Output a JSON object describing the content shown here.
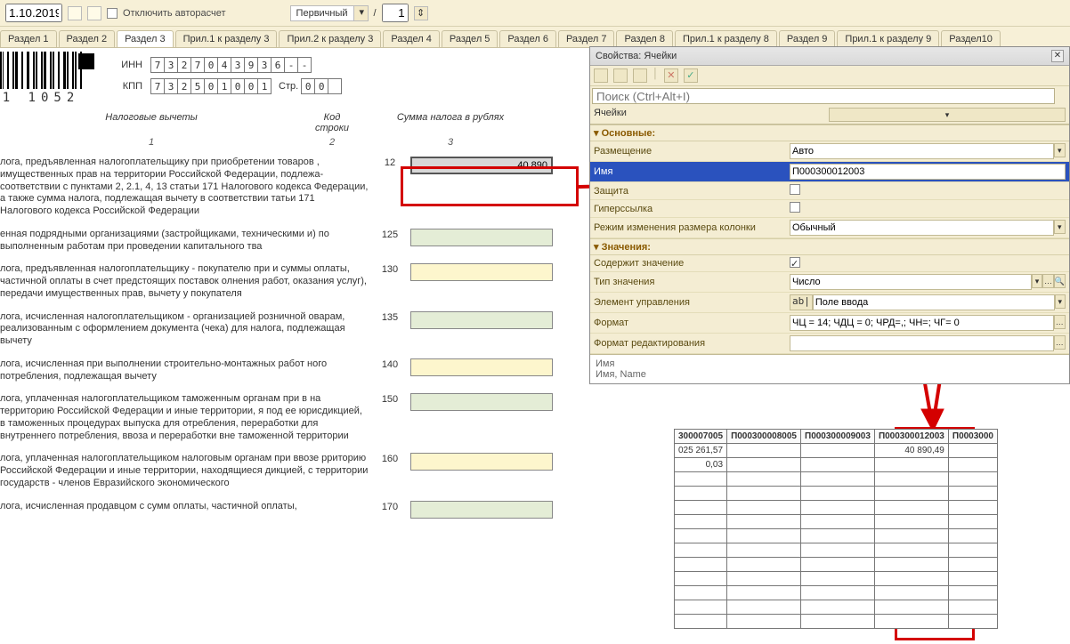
{
  "topbar": {
    "date": "1.10.2019",
    "disable_autocalc": "Отключить авторасчет",
    "doctype": "Первичный",
    "slash": "/",
    "num": "1",
    "dd": "▾"
  },
  "tabs": [
    "Раздел 1",
    "Раздел 2",
    "Раздел 3",
    "Прил.1 к разделу 3",
    "Прил.2 к разделу 3",
    "Раздел 4",
    "Раздел 5",
    "Раздел 6",
    "Раздел 7",
    "Раздел 8",
    "Прил.1 к разделу 8",
    "Раздел 9",
    "Прил.1 к разделу 9",
    "Раздел10"
  ],
  "active_tab": 2,
  "header": {
    "inn_label": "ИНН",
    "inn": [
      "7",
      "3",
      "2",
      "7",
      "0",
      "4",
      "3",
      "9",
      "3",
      "6",
      "-",
      "-"
    ],
    "kpp_label": "КПП",
    "kpp": [
      "7",
      "3",
      "2",
      "5",
      "0",
      "1",
      "0",
      "0",
      "1"
    ],
    "str_label": "Стр.",
    "str": [
      "0",
      "0",
      ""
    ],
    "barcode_text": "1 1052"
  },
  "cols": {
    "tax": "Налоговые вычеты",
    "code": "Код\nстроки",
    "sum": "Сумма налога в рублях",
    "n1": "1",
    "n2": "2",
    "n3": "3"
  },
  "rows": [
    {
      "txt": "лога, предъявленная налогоплательщику при приобретении товаров , имущественных прав на территории Российской Федерации, подлежа- соответствии с пунктами 2, 2.1, 4, 13 статьи 171 Налогового кодекса Федерации, а также сумма налога, подлежащая вычету в соответствии татьи 171 Налогового кодекса Российской Федерации",
      "code": "12",
      "val": "40 890",
      "hl": true
    },
    {
      "txt": "енная подрядными организациями (застройщиками, техническими и) по выполненным работам при проведении капитального тва",
      "code": "125",
      "val": ""
    },
    {
      "txt": "лога, предъявленная налогоплательщику - покупателю при и суммы оплаты, частичной оплаты в счет предстоящих поставок олнения работ, оказания услуг), передачи имущественных прав, вычету у покупателя",
      "code": "130",
      "val": ""
    },
    {
      "txt": "лога, исчисленная налогоплательщиком - организацией розничной оварам, реализованным с оформлением документа (чека) для  налога, подлежащая вычету",
      "code": "135",
      "val": ""
    },
    {
      "txt": "лога, исчисленная при выполнении строительно-монтажных работ ного потребления, подлежащая вычету",
      "code": "140",
      "val": ""
    },
    {
      "txt": "лога, уплаченная налогоплательщиком таможенным органам при в на территорию Российской Федерации и иные территории, я под ее юрисдикцией, в таможенных процедурах выпуска для отребления, переработки для внутреннего потребления, ввоза и переработки вне таможенной территории",
      "code": "150",
      "val": ""
    },
    {
      "txt": "лога, уплаченная налогоплательщиком налоговым органам при ввозе рриторию Российской Федерации и иные территории, находящиеся дикцией, с территории государств - членов Евразийского экономического",
      "code": "160",
      "val": ""
    },
    {
      "txt": "лога, исчисленная продавцом с сумм оплаты, частичной оплаты,",
      "code": "170",
      "val": ""
    }
  ],
  "props": {
    "title": "Свойства: Ячейки",
    "search_ph": "Поиск (Ctrl+Alt+I)",
    "category": "Ячейки",
    "sec_main": "Основные:",
    "sec_vals": "Значения:",
    "rows_main": [
      {
        "k": "Размещение",
        "v": "Авто",
        "dd": true
      },
      {
        "k": "Имя",
        "v": "П000300012003",
        "hl": true
      },
      {
        "k": "Защита",
        "v": "",
        "check": true
      },
      {
        "k": "Гиперссылка",
        "v": "",
        "check": true
      },
      {
        "k": "Режим изменения размера колонки",
        "v": "Обычный",
        "dd": true
      }
    ],
    "rows_vals": [
      {
        "k": "Содержит значение",
        "v": "",
        "check": true,
        "checked": true
      },
      {
        "k": "Тип значения",
        "v": "Число",
        "dd": true,
        "extra": true
      },
      {
        "k": "Элемент управления",
        "v": "Поле ввода",
        "dd": true,
        "prefix": "ab|"
      },
      {
        "k": "Формат",
        "v": "ЧЦ = 14; ЧДЦ = 0; ЧРД=,; ЧН=; ЧГ= 0",
        "btn": true
      },
      {
        "k": "Формат редактирования",
        "v": "",
        "btn": true
      }
    ],
    "foot1": "Имя",
    "foot2": "Имя, Name"
  },
  "table": {
    "headers": [
      "300007005",
      "П000300008005",
      "П000300009003",
      "П000300012003",
      "П0003000"
    ],
    "row1": [
      "025 261,57",
      "",
      "",
      "40 890,49",
      ""
    ],
    "row2": [
      "0,03",
      "",
      "",
      "",
      ""
    ]
  },
  "icons": {
    "close": "✕",
    "check": "✓",
    "dd": "▾",
    "dots": "…",
    "x": "✕"
  }
}
